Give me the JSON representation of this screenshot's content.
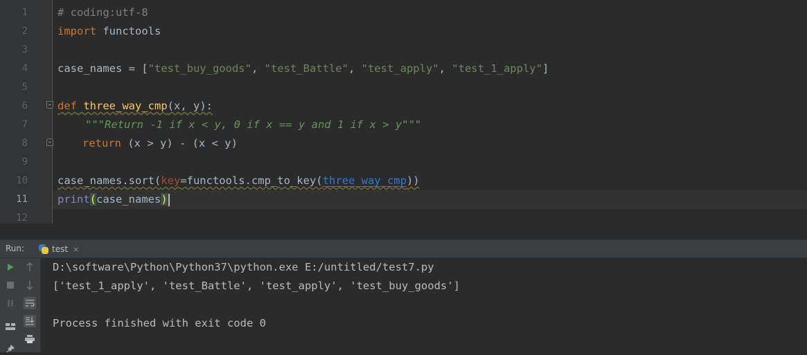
{
  "editor": {
    "line_numbers": [
      "1",
      "2",
      "3",
      "4",
      "5",
      "6",
      "7",
      "8",
      "9",
      "10",
      "11",
      "12"
    ],
    "current_line": "11",
    "code": {
      "l1_comment": "# coding:utf-8",
      "l2_import": "import",
      "l2_module": " functools",
      "l4_var": "case_names = [",
      "l4_s1": "\"test_buy_goods\"",
      "l4_s2": "\"test_Battle\"",
      "l4_s3": "\"test_apply\"",
      "l4_s4": "\"test_1_apply\"",
      "l4_sep": ", ",
      "l4_close": "]",
      "l6_def": "def",
      "l6_name": "three_way_cmp",
      "l6_args": "(x, y):",
      "l7_doc": "\"\"\"Return -1 if x < y, 0 if x == y and 1 if x > y\"\"\"",
      "l8_return": "return",
      "l8_expr_a": " (x > y) - (x < y)",
      "l10_call": "case_names.sort(",
      "l10_key": "key",
      "l10_mid": "=functools.cmp_to_key(",
      "l10_ref": "three_way_cmp",
      "l10_close": "))",
      "l11_print": "print",
      "l11_open": "(",
      "l11_arg": "case_names",
      "l11_close": ")"
    }
  },
  "run_panel": {
    "label": "Run:",
    "tab_name": "test",
    "tab_close": "×",
    "output": [
      "D:\\software\\Python\\Python37\\python.exe E:/untitled/test7.py",
      "['test_1_apply', 'test_Battle', 'test_apply', 'test_buy_goods']",
      "",
      "Process finished with exit code 0"
    ]
  },
  "colors": {
    "background": "#2b2b2b",
    "keyword": "#cc7832",
    "string": "#6a8759",
    "function": "#ffc66d",
    "builtin": "#8888c6",
    "run_green": "#499c54"
  }
}
